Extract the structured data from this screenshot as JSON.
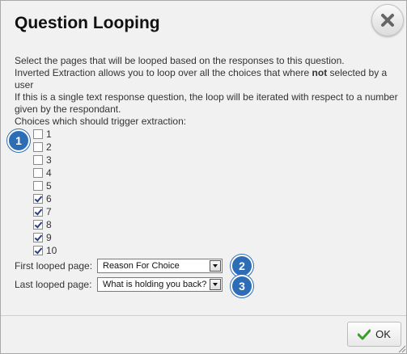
{
  "dialog": {
    "title": "Question Looping",
    "close_icon": "close-icon"
  },
  "instructions": {
    "line1": "Select the pages that will be looped based on the responses to this question.",
    "line2_before": "Inverted Extraction allows you to loop over all the choices that where ",
    "line2_bold": "not",
    "line2_after": " selected by a user",
    "line3": "If this is a single text response question, the loop will be iterated with respect to a number given by the respondant.",
    "line4": "Choices which should trigger extraction:"
  },
  "choices": [
    {
      "label": "1",
      "checked": false
    },
    {
      "label": "2",
      "checked": false
    },
    {
      "label": "3",
      "checked": false
    },
    {
      "label": "4",
      "checked": false
    },
    {
      "label": "5",
      "checked": false
    },
    {
      "label": "6",
      "checked": true
    },
    {
      "label": "7",
      "checked": true
    },
    {
      "label": "8",
      "checked": true
    },
    {
      "label": "9",
      "checked": true
    },
    {
      "label": "10",
      "checked": true
    }
  ],
  "first_page": {
    "label": "First looped page:",
    "value": "Reason For Choice"
  },
  "last_page": {
    "label": "Last looped page:",
    "value": "What is holding you back?"
  },
  "badges": [
    "1",
    "2",
    "3"
  ],
  "footer": {
    "ok_label": "OK"
  },
  "colors": {
    "badge": "#2d6db5",
    "ok_check": "#3d9a2c"
  }
}
